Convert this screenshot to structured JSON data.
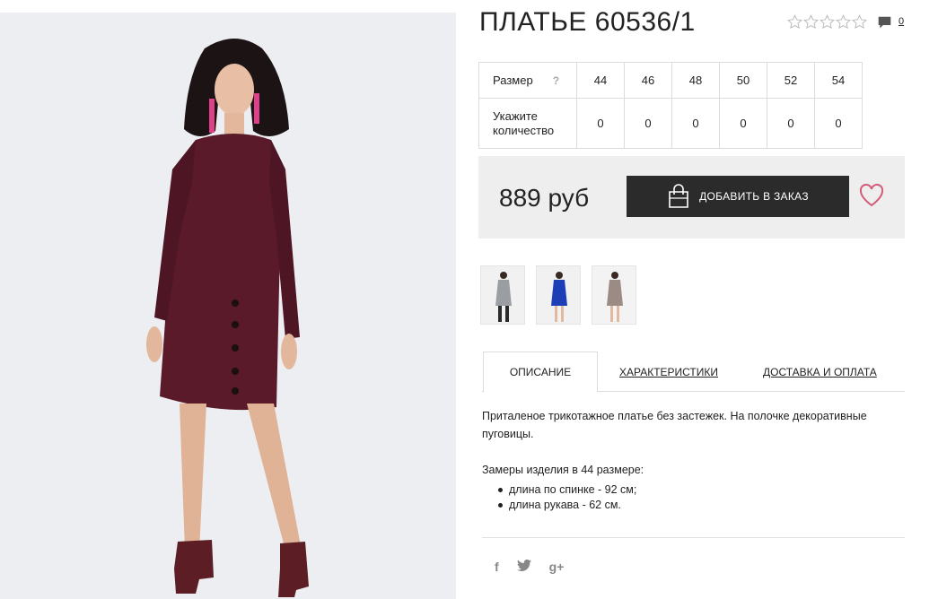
{
  "product": {
    "title": "ПЛАТЬЕ 60536/1",
    "rating_stars": 5,
    "rating_value": 0,
    "comments_count": "0",
    "image_alt": "Бордовое платье"
  },
  "sizes": {
    "size_label": "Размер",
    "help": "?",
    "values": [
      "44",
      "46",
      "48",
      "50",
      "52",
      "54"
    ],
    "qty_label_1": "Укажите",
    "qty_label_2": "количество",
    "quantities": [
      "0",
      "0",
      "0",
      "0",
      "0",
      "0"
    ]
  },
  "purchase": {
    "price": "889 руб",
    "add_button": "ДОБАВИТЬ В ЗАКАЗ"
  },
  "thumbnails": [
    {
      "color": "grey"
    },
    {
      "color": "blue"
    },
    {
      "color": "beige"
    }
  ],
  "tabs": {
    "description": "ОПИСАНИЕ",
    "characteristics": "ХАРАКТЕРИСТИКИ",
    "delivery": "ДОСТАВКА И ОПЛАТА"
  },
  "description": {
    "text": "Приталеное трикотажное платье без застежек. На полочке декоративные пуговицы.",
    "measurements_title": "Замеры изделия в 44 размере:",
    "measurements": [
      "длина по спинке - 92 см;",
      "длина рукава - 62 см."
    ]
  },
  "social": {
    "facebook": "f",
    "twitter": "t",
    "googleplus": "g+"
  },
  "colors": {
    "dress": "#5a1a2a",
    "button_bg": "#2b2b2b",
    "price_box": "#eeeeee",
    "heart": "#d35c7a"
  }
}
